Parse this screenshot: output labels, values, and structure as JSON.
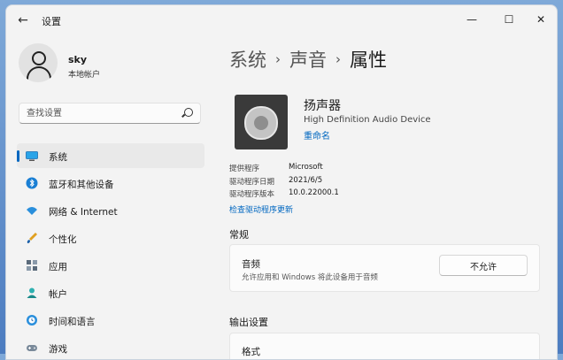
{
  "window": {
    "title": "设置",
    "controls": {
      "minimize": "—",
      "maximize": "☐",
      "close": "✕"
    }
  },
  "profile": {
    "name": "sky",
    "account": "本地帐户"
  },
  "search": {
    "placeholder": "查找设置"
  },
  "nav": {
    "items": [
      {
        "label": "系统",
        "icon": "monitor-icon",
        "active": true
      },
      {
        "label": "蓝牙和其他设备",
        "icon": "bluetooth-icon"
      },
      {
        "label": "网络 & Internet",
        "icon": "wifi-icon"
      },
      {
        "label": "个性化",
        "icon": "brush-icon"
      },
      {
        "label": "应用",
        "icon": "apps-icon"
      },
      {
        "label": "帐户",
        "icon": "account-icon"
      },
      {
        "label": "时间和语言",
        "icon": "globe-clock-icon"
      },
      {
        "label": "游戏",
        "icon": "gamepad-icon"
      }
    ]
  },
  "breadcrumb": {
    "level1": "系统",
    "level2": "声音",
    "current": "属性",
    "separator": "›"
  },
  "device": {
    "name": "扬声器",
    "description": "High Definition Audio Device",
    "rename_label": "重命名",
    "icon": "speaker-icon"
  },
  "driver_info": [
    {
      "label": "提供程序",
      "value": "Microsoft"
    },
    {
      "label": "驱动程序日期",
      "value": "2021/6/5"
    },
    {
      "label": "驱动程序版本",
      "value": "10.0.22000.1"
    }
  ],
  "update_driver_link": "检查驱动程序更新",
  "general": {
    "title": "常规",
    "audio": {
      "title": "音频",
      "subtitle": "允许应用和 Windows 将此设备用于音频",
      "button_label": "不允许"
    }
  },
  "output": {
    "title": "输出设置",
    "format_label": "格式"
  },
  "colors": {
    "accent": "#0067c0",
    "background": "#f3f3f3",
    "card": "#fbfbfb"
  }
}
